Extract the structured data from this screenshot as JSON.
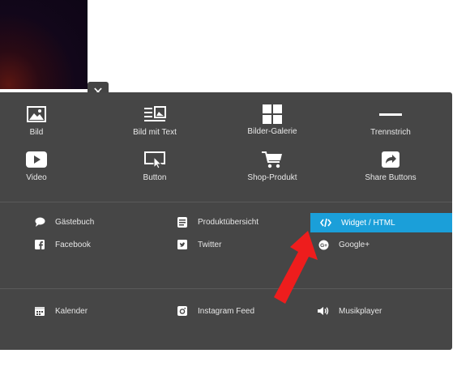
{
  "close_symbol": "✕",
  "accent_color": "#1b9fd9",
  "arrow_color": "#ee1d1d",
  "grid_items": [
    {
      "label": "Bild",
      "icon": "image-icon"
    },
    {
      "label": "Bild mit Text",
      "icon": "image-text-icon"
    },
    {
      "label": "Bilder-Galerie",
      "icon": "gallery-grid-icon"
    },
    {
      "label": "Trennstrich",
      "icon": "divider-line-icon"
    },
    {
      "label": "Video",
      "icon": "video-play-icon"
    },
    {
      "label": "Button",
      "icon": "button-cursor-icon"
    },
    {
      "label": "Shop-Produkt",
      "icon": "shopping-cart-icon"
    },
    {
      "label": "Share Buttons",
      "icon": "share-icon"
    }
  ],
  "list_items": [
    {
      "label": "Gästebuch",
      "icon": "speech-bubble-icon"
    },
    {
      "label": "Produktübersicht",
      "icon": "product-list-icon"
    },
    {
      "label": "Widget / HTML",
      "icon": "code-icon",
      "active": true
    },
    {
      "label": "Facebook",
      "icon": "facebook-icon"
    },
    {
      "label": "Twitter",
      "icon": "twitter-icon"
    },
    {
      "label": "Google+",
      "icon": "google-plus-icon"
    },
    {
      "label": "Kalender",
      "icon": "calendar-icon"
    },
    {
      "label": "Instagram Feed",
      "icon": "instagram-icon"
    },
    {
      "label": "Musikplayer",
      "icon": "speaker-icon"
    }
  ]
}
